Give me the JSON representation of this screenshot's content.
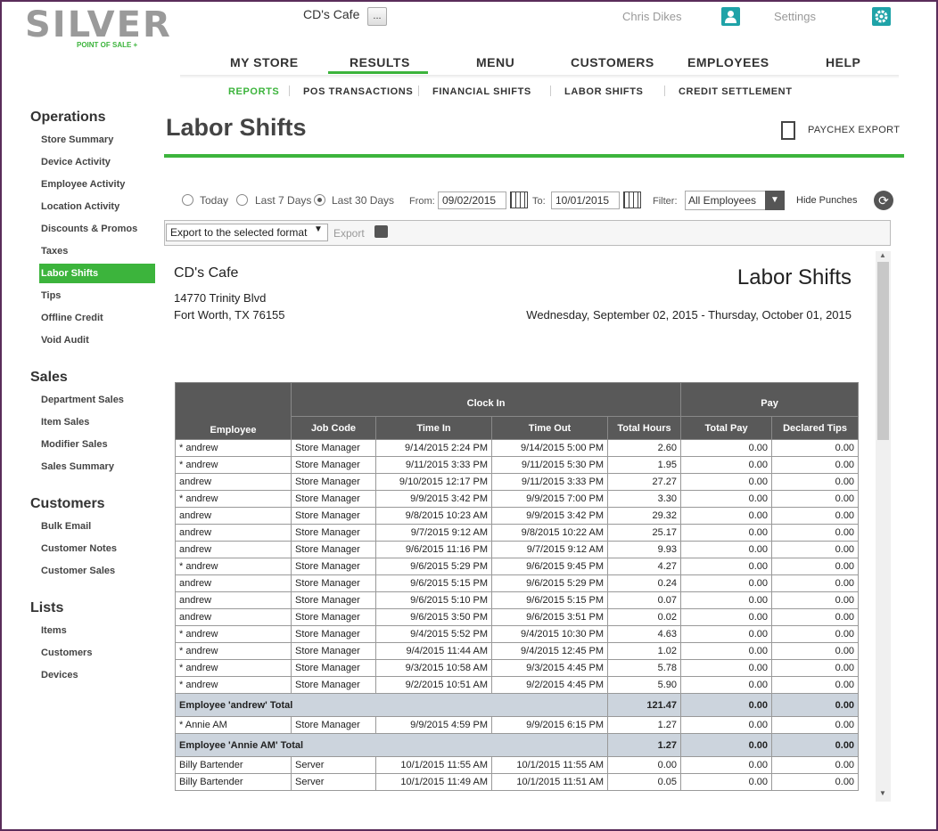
{
  "header": {
    "logo_text": "SILVER",
    "logo_sub": "POINT OF SALE +",
    "store_name": "CD's Cafe",
    "store_btn": "...",
    "user_name": "Chris Dikes",
    "settings_label": "Settings"
  },
  "nav": {
    "items": [
      "MY STORE",
      "RESULTS",
      "MENU",
      "CUSTOMERS",
      "EMPLOYEES",
      "HELP"
    ],
    "active": "RESULTS"
  },
  "subnav": {
    "items": [
      "REPORTS",
      "POS TRANSACTIONS",
      "FINANCIAL SHIFTS",
      "LABOR SHIFTS",
      "CREDIT SETTLEMENT"
    ],
    "active": "REPORTS"
  },
  "sidebar": {
    "sections": [
      {
        "title": "Operations",
        "items": [
          "Store Summary",
          "Device Activity",
          "Employee Activity",
          "Location Activity",
          "Discounts & Promos",
          "Taxes",
          "Labor Shifts",
          "Tips",
          "Offline Credit",
          "Void Audit"
        ]
      },
      {
        "title": "Sales",
        "items": [
          "Department Sales",
          "Item Sales",
          "Modifier Sales",
          "Sales Summary"
        ]
      },
      {
        "title": "Customers",
        "items": [
          "Bulk Email",
          "Customer Notes",
          "Customer Sales"
        ]
      },
      {
        "title": "Lists",
        "items": [
          "Items",
          "Customers",
          "Devices"
        ]
      }
    ],
    "active": "Labor Shifts"
  },
  "page": {
    "title": "Labor Shifts",
    "paychex_export": "PAYCHEX EXPORT"
  },
  "filters": {
    "radio_today": "Today",
    "radio_7": "Last 7 Days",
    "radio_30": "Last 30 Days",
    "selected_range": "Last 30 Days",
    "from_label": "From:",
    "from_value": "09/02/2015",
    "to_label": "To:",
    "to_value": "10/01/2015",
    "filter_label": "Filter:",
    "filter_value": "All Employees",
    "hide_punches": "Hide Punches"
  },
  "toolbar": {
    "export_format": "Export to the selected format",
    "export_label": "Export"
  },
  "report": {
    "store": "CD's Cafe",
    "address1": "14770 Trinity Blvd",
    "address2": "Fort Worth, TX 76155",
    "title": "Labor Shifts",
    "date_range": "Wednesday, September 02, 2015 - Thursday, October 01, 2015",
    "group_clock_in": "Clock In",
    "group_pay": "Pay",
    "columns": [
      "Employee",
      "Job Code",
      "Time In",
      "Time Out",
      "Total Hours",
      "Total Pay",
      "Declared Tips"
    ],
    "rows": [
      {
        "type": "row",
        "cells": [
          "* andrew",
          "Store Manager",
          "9/14/2015 2:24 PM",
          "9/14/2015 5:00 PM",
          "2.60",
          "0.00",
          "0.00"
        ]
      },
      {
        "type": "row",
        "cells": [
          "* andrew",
          "Store Manager",
          "9/11/2015 3:33 PM",
          "9/11/2015 5:30 PM",
          "1.95",
          "0.00",
          "0.00"
        ]
      },
      {
        "type": "row",
        "cells": [
          "andrew",
          "Store Manager",
          "9/10/2015 12:17 PM",
          "9/11/2015 3:33 PM",
          "27.27",
          "0.00",
          "0.00"
        ]
      },
      {
        "type": "row",
        "cells": [
          "* andrew",
          "Store Manager",
          "9/9/2015 3:42 PM",
          "9/9/2015 7:00 PM",
          "3.30",
          "0.00",
          "0.00"
        ]
      },
      {
        "type": "row",
        "cells": [
          "andrew",
          "Store Manager",
          "9/8/2015 10:23 AM",
          "9/9/2015 3:42 PM",
          "29.32",
          "0.00",
          "0.00"
        ]
      },
      {
        "type": "row",
        "cells": [
          "andrew",
          "Store Manager",
          "9/7/2015 9:12 AM",
          "9/8/2015 10:22 AM",
          "25.17",
          "0.00",
          "0.00"
        ]
      },
      {
        "type": "row",
        "cells": [
          "andrew",
          "Store Manager",
          "9/6/2015 11:16 PM",
          "9/7/2015 9:12 AM",
          "9.93",
          "0.00",
          "0.00"
        ]
      },
      {
        "type": "row",
        "cells": [
          "* andrew",
          "Store Manager",
          "9/6/2015 5:29 PM",
          "9/6/2015 9:45 PM",
          "4.27",
          "0.00",
          "0.00"
        ]
      },
      {
        "type": "row",
        "cells": [
          "andrew",
          "Store Manager",
          "9/6/2015 5:15 PM",
          "9/6/2015 5:29 PM",
          "0.24",
          "0.00",
          "0.00"
        ]
      },
      {
        "type": "row",
        "cells": [
          "andrew",
          "Store Manager",
          "9/6/2015 5:10 PM",
          "9/6/2015 5:15 PM",
          "0.07",
          "0.00",
          "0.00"
        ]
      },
      {
        "type": "row",
        "cells": [
          "andrew",
          "Store Manager",
          "9/6/2015 3:50 PM",
          "9/6/2015 3:51 PM",
          "0.02",
          "0.00",
          "0.00"
        ]
      },
      {
        "type": "row",
        "cells": [
          "* andrew",
          "Store Manager",
          "9/4/2015 5:52 PM",
          "9/4/2015 10:30 PM",
          "4.63",
          "0.00",
          "0.00"
        ]
      },
      {
        "type": "row",
        "cells": [
          "* andrew",
          "Store Manager",
          "9/4/2015 11:44 AM",
          "9/4/2015 12:45 PM",
          "1.02",
          "0.00",
          "0.00"
        ]
      },
      {
        "type": "row",
        "cells": [
          "* andrew",
          "Store Manager",
          "9/3/2015 10:58 AM",
          "9/3/2015 4:45 PM",
          "5.78",
          "0.00",
          "0.00"
        ]
      },
      {
        "type": "row",
        "cells": [
          "* andrew",
          "Store Manager",
          "9/2/2015 10:51 AM",
          "9/2/2015 4:45 PM",
          "5.90",
          "0.00",
          "0.00"
        ]
      },
      {
        "type": "total",
        "label": "Employee 'andrew' Total",
        "hours": "121.47",
        "pay": "0.00",
        "tips": "0.00"
      },
      {
        "type": "row",
        "cells": [
          "* Annie AM",
          "Store Manager",
          "9/9/2015 4:59 PM",
          "9/9/2015 6:15 PM",
          "1.27",
          "0.00",
          "0.00"
        ]
      },
      {
        "type": "total",
        "label": "Employee 'Annie AM' Total",
        "hours": "1.27",
        "pay": "0.00",
        "tips": "0.00"
      },
      {
        "type": "row",
        "cells": [
          "Billy Bartender",
          "Server",
          "10/1/2015 11:55 AM",
          "10/1/2015 11:55 AM",
          "0.00",
          "0.00",
          "0.00"
        ]
      },
      {
        "type": "row",
        "cells": [
          "Billy Bartender",
          "Server",
          "10/1/2015 11:49 AM",
          "10/1/2015 11:51 AM",
          "0.05",
          "0.00",
          "0.00"
        ]
      }
    ]
  }
}
